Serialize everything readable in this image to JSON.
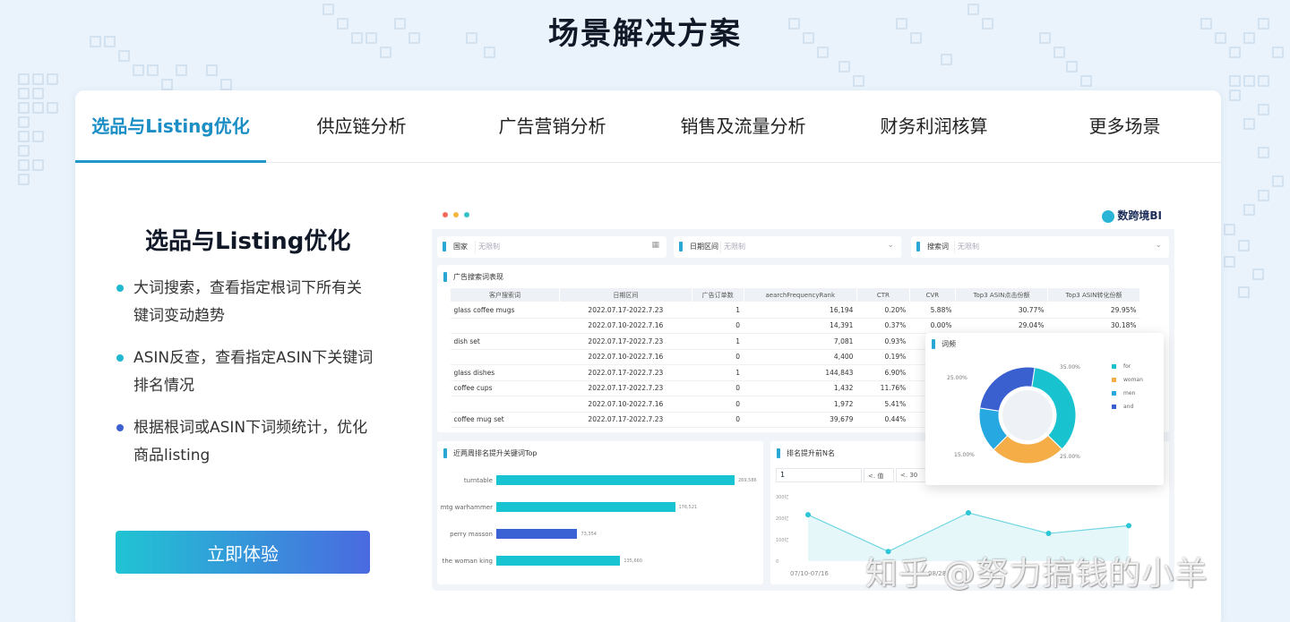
{
  "page_title": "场景解决方案",
  "tabs": [
    {
      "label": "选品与Listing优化",
      "active": true
    },
    {
      "label": "供应链分析"
    },
    {
      "label": "广告营销分析"
    },
    {
      "label": "销售及流量分析"
    },
    {
      "label": "财务利润核算"
    },
    {
      "label": "更多场景"
    }
  ],
  "feature": {
    "title": "选品与Listing优化",
    "bullets": [
      "大词搜索，查看指定根词下所有关键词变动趋势",
      "ASIN反查，查看指定ASIN下关键词排名情况",
      "根据根词或ASIN下词频统计，优化商品listing"
    ],
    "cta_label": "立即体验"
  },
  "dashboard": {
    "brand": "数跨境BI",
    "filters": [
      {
        "label": "国家",
        "value": "无限制",
        "icon": "calendar-icon"
      },
      {
        "label": "日期区间",
        "value": "无限制",
        "icon": "chevron-down-icon"
      },
      {
        "label": "搜索词",
        "value": "无限制",
        "icon": "chevron-down-icon"
      }
    ],
    "keyword_table": {
      "title": "广告搜索词表现",
      "headers": [
        "客户搜索词",
        "日期区间",
        "广告订单数",
        "aearchFrequencyRank",
        "CTR",
        "CVR",
        "Top3 ASIN点击份额",
        "Top3 ASIN转化份额"
      ],
      "rows": [
        {
          "term": "glass coffee mugs",
          "date": "2022.07.17-2022.7.23",
          "orders": "1",
          "rank": "16,194",
          "ctr": "0.20%",
          "cvr": "5.88%",
          "click": "30.77%",
          "conv": "29.95%"
        },
        {
          "term": "",
          "date": "2022.07.10-2022.7.16",
          "orders": "0",
          "rank": "14,391",
          "ctr": "0.37%",
          "cvr": "0.00%",
          "click": "29.04%",
          "conv": "30.18%"
        },
        {
          "term": "dish set",
          "date": "2022.07.17-2022.7.23",
          "orders": "1",
          "rank": "7,081",
          "ctr": "0.93%",
          "cvr": "",
          "click": "",
          "conv": ""
        },
        {
          "term": "",
          "date": "2022.07.10-2022.7.16",
          "orders": "0",
          "rank": "4,400",
          "ctr": "0.19%",
          "cvr": "",
          "click": "",
          "conv": ""
        },
        {
          "term": "glass dishes",
          "date": "2022.07.17-2022.7.23",
          "orders": "1",
          "rank": "144,843",
          "ctr": "6.90%",
          "cvr": "",
          "click": "",
          "conv": ""
        },
        {
          "term": "coffee cups",
          "date": "2022.07.17-2022.7.23",
          "orders": "0",
          "rank": "1,432",
          "ctr": "11.76%",
          "cvr": "",
          "click": "",
          "conv": ""
        },
        {
          "term": "",
          "date": "2022.07.10-2022.7.16",
          "orders": "0",
          "rank": "1,972",
          "ctr": "5.41%",
          "cvr": "",
          "click": "",
          "conv": ""
        },
        {
          "term": "coffee mug set",
          "date": "2022.07.17-2022.7.23",
          "orders": "0",
          "rank": "39,679",
          "ctr": "0.44%",
          "cvr": "",
          "click": "",
          "conv": ""
        }
      ]
    },
    "bar_panel": {
      "title": "近两周排名提升关键词Top",
      "bars": [
        {
          "label": "turntable",
          "value": "269,586",
          "frac": 1.0,
          "color": "#19c4d2"
        },
        {
          "label": "mtg warhammer",
          "value": "176,521",
          "frac": 0.75,
          "color": "#19c4d2"
        },
        {
          "label": "perry masson",
          "value": "73,354",
          "frac": 0.34,
          "color": "#3a62d4"
        },
        {
          "label": "the woman king",
          "value": "135,660",
          "frac": 0.52,
          "color": "#19c4d2"
        }
      ]
    },
    "line_panel": {
      "title": "排名提升前N名",
      "input_value": "1",
      "ctrl1": "<. 值",
      "ctrl2": "<. 30",
      "y_ticks": [
        "300亿",
        "200亿",
        "100亿",
        "0"
      ],
      "x_label_first": "07/10-07/16",
      "x_label_mid": "08/28",
      "points": [
        0.72,
        0.15,
        0.75,
        0.43,
        0.55
      ]
    },
    "donut": {
      "title": "词频",
      "slices": [
        {
          "name": "for",
          "value": 35,
          "color": "#18c3cf"
        },
        {
          "name": "woman",
          "value": 25,
          "color": "#f5ad47"
        },
        {
          "name": "men",
          "value": 15,
          "color": "#27a8e0"
        },
        {
          "name": "and",
          "value": 25,
          "color": "#3a5fcf"
        }
      ],
      "labels": [
        "35.00%",
        "25.00%",
        "15.00%",
        "25.00%"
      ]
    }
  },
  "watermark": "知乎 @努力搞钱的小羊"
}
